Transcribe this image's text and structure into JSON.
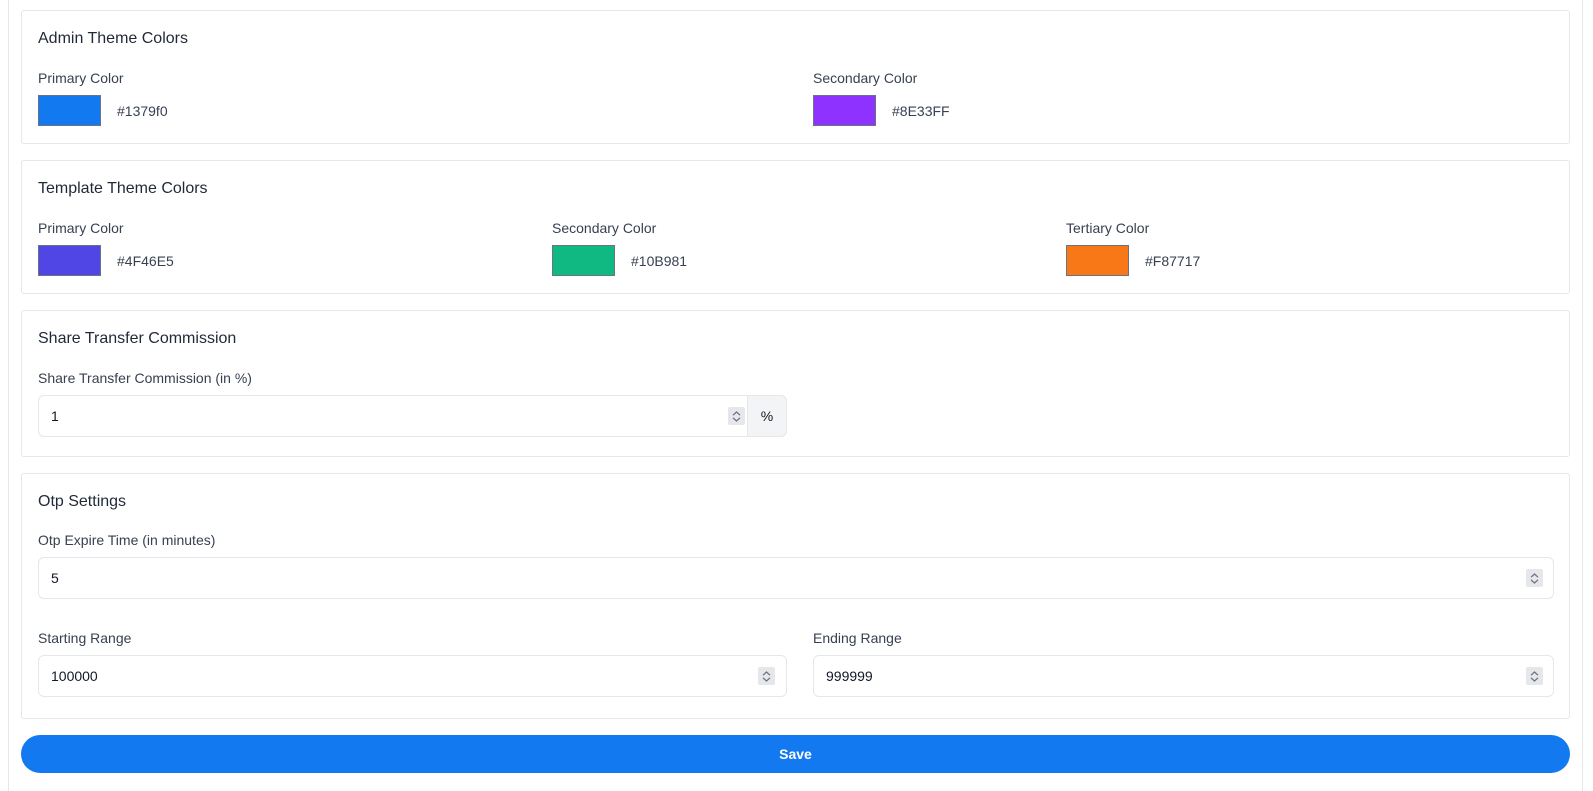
{
  "admin_theme": {
    "title": "Admin Theme Colors",
    "primary": {
      "label": "Primary Color",
      "value": "#1379f0",
      "color": "#1379f0"
    },
    "secondary": {
      "label": "Secondary Color",
      "value": "#8E33FF",
      "color": "#8E33FF"
    }
  },
  "template_theme": {
    "title": "Template Theme Colors",
    "primary": {
      "label": "Primary Color",
      "value": "#4F46E5",
      "color": "#4F46E5"
    },
    "secondary": {
      "label": "Secondary Color",
      "value": "#10B981",
      "color": "#10B981"
    },
    "tertiary": {
      "label": "Tertiary Color",
      "value": "#F87717",
      "color": "#F87717"
    }
  },
  "share_transfer": {
    "title": "Share Transfer Commission",
    "field_label": "Share Transfer Commission (in %)",
    "value": "1",
    "suffix": "%"
  },
  "otp": {
    "title": "Otp Settings",
    "expire_label": "Otp Expire Time (in minutes)",
    "expire_value": "5",
    "starting_label": "Starting Range",
    "starting_value": "100000",
    "ending_label": "Ending Range",
    "ending_value": "999999"
  },
  "actions": {
    "save_label": "Save"
  },
  "icons": {
    "spinner": "chevron-up-down-icon"
  }
}
